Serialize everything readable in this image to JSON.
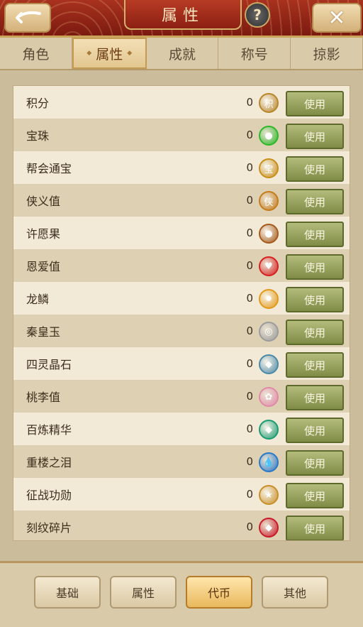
{
  "header": {
    "title": "属性",
    "help_label": "?",
    "close_label": "✕"
  },
  "tabs": [
    {
      "label": "角色",
      "active": false
    },
    {
      "label": "属性",
      "active": true
    },
    {
      "label": "成就",
      "active": false
    },
    {
      "label": "称号",
      "active": false
    },
    {
      "label": "掠影",
      "active": false
    }
  ],
  "currencies": [
    {
      "name": "积分",
      "count": "0",
      "icon": "jifen-icon",
      "glyph": "积",
      "color": "#b8862c"
    },
    {
      "name": "宝珠",
      "count": "0",
      "icon": "green-orb-icon",
      "glyph": "●",
      "color": "#2fb82a"
    },
    {
      "name": "帮会通宝",
      "count": "0",
      "icon": "guild-coin-icon",
      "glyph": "宝",
      "color": "#c88f1c"
    },
    {
      "name": "侠义值",
      "count": "0",
      "icon": "xia-icon",
      "glyph": "侠",
      "color": "#c47c1c"
    },
    {
      "name": "许愿果",
      "count": "0",
      "icon": "wish-fruit-icon",
      "glyph": "●",
      "color": "#a65a1c"
    },
    {
      "name": "恩爱值",
      "count": "0",
      "icon": "heart-icon",
      "glyph": "♥",
      "color": "#d62222"
    },
    {
      "name": "龙鳞",
      "count": "0",
      "icon": "dragon-scale-icon",
      "glyph": "✹",
      "color": "#e39a1a"
    },
    {
      "name": "秦皇玉",
      "count": "0",
      "icon": "jade-icon",
      "glyph": "◎",
      "color": "#9c9c9c"
    },
    {
      "name": "四灵晶石",
      "count": "0",
      "icon": "crystal-icon",
      "glyph": "◆",
      "color": "#4c8aa8"
    },
    {
      "name": "桃李值",
      "count": "0",
      "icon": "flower-icon",
      "glyph": "✿",
      "color": "#e08aa8"
    },
    {
      "name": "百炼精华",
      "count": "0",
      "icon": "emerald-icon",
      "glyph": "◆",
      "color": "#1c9c72"
    },
    {
      "name": "重楼之泪",
      "count": "0",
      "icon": "teardrop-icon",
      "glyph": "💧",
      "color": "#2a78c8"
    },
    {
      "name": "征战功勋",
      "count": "0",
      "icon": "merit-badge-icon",
      "glyph": "★",
      "color": "#c8902a"
    },
    {
      "name": "刻纹碎片",
      "count": "0",
      "icon": "ruby-shard-icon",
      "glyph": "◆",
      "color": "#c81c2a"
    }
  ],
  "use_label": "使用",
  "footer_tabs": [
    {
      "label": "基础",
      "active": false
    },
    {
      "label": "属性",
      "active": false
    },
    {
      "label": "代币",
      "active": true
    },
    {
      "label": "其他",
      "active": false
    }
  ]
}
